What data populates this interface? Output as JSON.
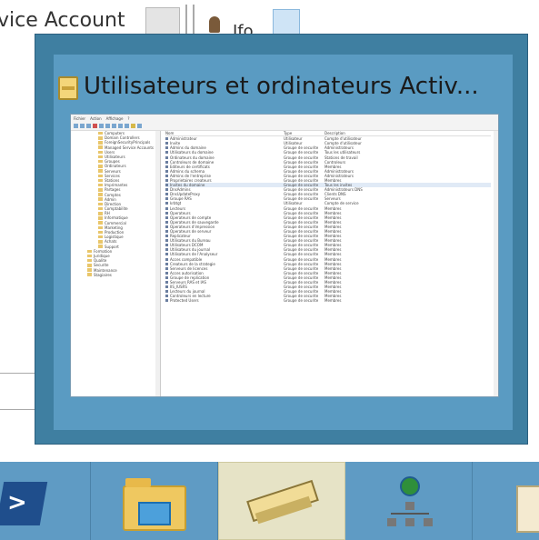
{
  "background": {
    "title": "vice Account",
    "user_fragment": "Ifo"
  },
  "preview": {
    "title": "Utilisateurs et ordinateurs Activ...",
    "thumbnail": {
      "menu": [
        "Fichier",
        "Action",
        "Affichage",
        "?"
      ],
      "tree_items": [
        "Computers",
        "Domain Controllers",
        "ForeignSecurityPrincipals",
        "Managed Service Accounts",
        "Users",
        "Utilisateurs",
        "Groupes",
        "Ordinateurs",
        "Serveurs",
        "Services",
        "Stations",
        "Imprimantes",
        "Partages",
        "Comptes",
        "Admin",
        "Direction",
        "Comptabilite",
        "RH",
        "Informatique",
        "Commercial",
        "Marketing",
        "Production",
        "Logistique",
        "Achats",
        "Support",
        "Formation",
        "Juridique",
        "Qualite",
        "Securite",
        "Maintenance",
        "Stagiaires"
      ],
      "list_header": [
        "Nom",
        "Type",
        "Description"
      ],
      "list_rows": [
        [
          "Administrateur",
          "Utilisateur",
          "Compte d'utilisateur"
        ],
        [
          "Invite",
          "Utilisateur",
          "Compte d'utilisateur"
        ],
        [
          "Admins du domaine",
          "Groupe de securite",
          "Administrateurs"
        ],
        [
          "Utilisateurs du domaine",
          "Groupe de securite",
          "Tous les utilisateurs"
        ],
        [
          "Ordinateurs du domaine",
          "Groupe de securite",
          "Stations de travail"
        ],
        [
          "Controleurs de domaine",
          "Groupe de securite",
          "Controleurs"
        ],
        [
          "Editeurs de certificats",
          "Groupe de securite",
          "Membres"
        ],
        [
          "Admins du schema",
          "Groupe de securite",
          "Administrateurs"
        ],
        [
          "Admins de l'entreprise",
          "Groupe de securite",
          "Administrateurs"
        ],
        [
          "Proprietaires createurs",
          "Groupe de securite",
          "Membres"
        ],
        [
          "Invites du domaine",
          "Groupe de securite",
          "Tous les invites"
        ],
        [
          "DnsAdmins",
          "Groupe de securite",
          "Administrateurs DNS"
        ],
        [
          "DnsUpdateProxy",
          "Groupe de securite",
          "Clients DNS"
        ],
        [
          "Groupe RAS",
          "Groupe de securite",
          "Serveurs"
        ],
        [
          "krbtgt",
          "Utilisateur",
          "Compte de service"
        ],
        [
          "Lecteurs",
          "Groupe de securite",
          "Membres"
        ],
        [
          "Operateurs",
          "Groupe de securite",
          "Membres"
        ],
        [
          "Operateurs de compte",
          "Groupe de securite",
          "Membres"
        ],
        [
          "Operateurs de sauvegarde",
          "Groupe de securite",
          "Membres"
        ],
        [
          "Operateurs d'impression",
          "Groupe de securite",
          "Membres"
        ],
        [
          "Operateurs de serveur",
          "Groupe de securite",
          "Membres"
        ],
        [
          "Replicateur",
          "Groupe de securite",
          "Membres"
        ],
        [
          "Utilisateurs du Bureau",
          "Groupe de securite",
          "Membres"
        ],
        [
          "Utilisateurs DCOM",
          "Groupe de securite",
          "Membres"
        ],
        [
          "Utilisateurs du journal",
          "Groupe de securite",
          "Membres"
        ],
        [
          "Utilisateurs de l'Analyseur",
          "Groupe de securite",
          "Membres"
        ],
        [
          "Acces compatible",
          "Groupe de securite",
          "Membres"
        ],
        [
          "Createurs de la strategie",
          "Groupe de securite",
          "Membres"
        ],
        [
          "Serveurs de licences",
          "Groupe de securite",
          "Membres"
        ],
        [
          "Acces autorisation",
          "Groupe de securite",
          "Membres"
        ],
        [
          "Groupe de replication",
          "Groupe de securite",
          "Membres"
        ],
        [
          "Serveurs RAS et IAS",
          "Groupe de securite",
          "Membres"
        ],
        [
          "IIS_IUSRS",
          "Groupe de securite",
          "Membres"
        ],
        [
          "Lecteurs du journal",
          "Groupe de securite",
          "Membres"
        ],
        [
          "Controleurs en lecture",
          "Groupe de securite",
          "Membres"
        ],
        [
          "Protected Users",
          "Groupe de securite",
          "Membres"
        ]
      ]
    }
  },
  "taskbar": {
    "buttons": [
      {
        "name": "powershell",
        "icon": "powershell-icon"
      },
      {
        "name": "file-explorer",
        "icon": "folder-icon"
      },
      {
        "name": "active-directory",
        "icon": "ad-users-icon",
        "active": true
      },
      {
        "name": "network",
        "icon": "network-globe-icon"
      },
      {
        "name": "document",
        "icon": "document-icon"
      }
    ]
  },
  "colors": {
    "taskbar": "#5f9bc4",
    "preview_border": "#3f7fa1",
    "preview_fill": "#5a9bc2",
    "active_button": "#e6e3c6"
  }
}
